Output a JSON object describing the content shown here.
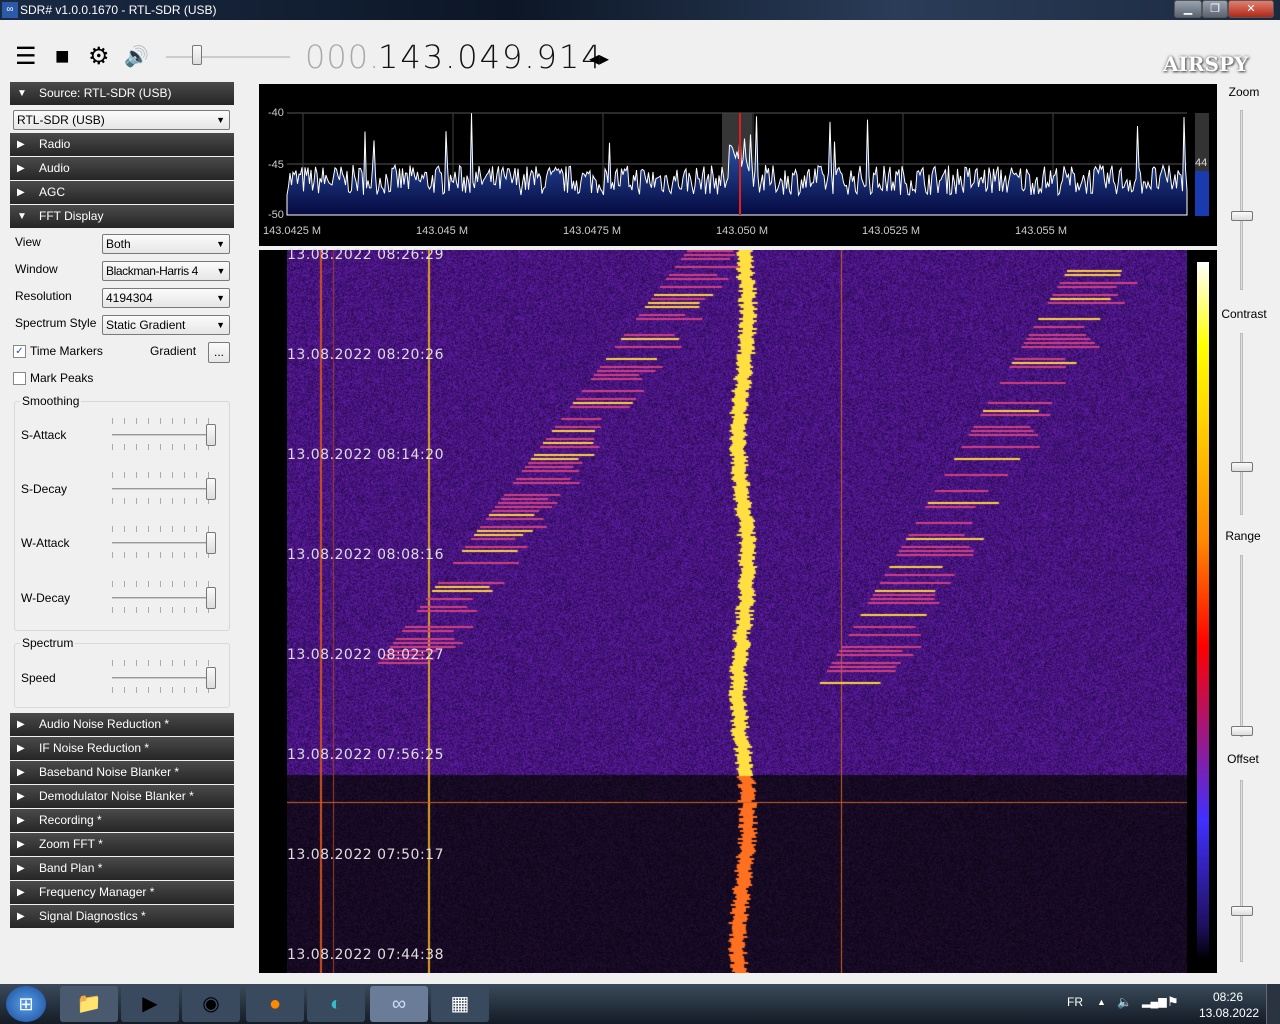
{
  "window": {
    "title": "SDR# v1.0.0.1670 - RTL-SDR (USB)",
    "min": "▁",
    "max": "❐",
    "close": "✕"
  },
  "toolbar": {
    "menu_icon": "☰",
    "stop_icon": "■",
    "settings_icon": "⚙",
    "volume_icon": "🔊",
    "volume_level": 0.15,
    "freq_prefix": "000.",
    "frequency": "143.049.914",
    "tune_icon": "◂▸",
    "logo": "AIRSPY"
  },
  "sidebar": {
    "source_header": "Source: RTL-SDR (USB)",
    "source_value": "RTL-SDR (USB)",
    "sections_top": [
      "Radio",
      "Audio",
      "AGC"
    ],
    "fft_header": "FFT Display",
    "view": {
      "label": "View",
      "value": "Both"
    },
    "window": {
      "label": "Window",
      "value": "Blackman-Harris 4"
    },
    "resolution": {
      "label": "Resolution",
      "value": "4194304"
    },
    "style": {
      "label": "Spectrum Style",
      "value": "Static Gradient"
    },
    "time_markers": {
      "label": "Time Markers",
      "checked": true
    },
    "gradient": {
      "label": "Gradient",
      "button": "..."
    },
    "mark_peaks": {
      "label": "Mark Peaks",
      "checked": false
    },
    "smoothing": {
      "title": "Smoothing",
      "sliders": [
        "S-Attack",
        "S-Decay",
        "W-Attack",
        "W-Decay"
      ]
    },
    "spectrum": {
      "title": "Spectrum",
      "speed": "Speed"
    },
    "sections_bottom": [
      "Audio Noise Reduction *",
      "IF Noise Reduction *",
      "Baseband Noise Blanker *",
      "Demodulator Noise Blanker *",
      "Recording *",
      "Zoom FFT *",
      "Band Plan *",
      "Frequency Manager *",
      "Signal Diagnostics *"
    ]
  },
  "spectrum": {
    "y_ticks": [
      "-40",
      "-45",
      "-50"
    ],
    "x_ticks": [
      "143.0425 M",
      "143.045 M",
      "143.0475 M",
      "143.050 M",
      "143.0525 M",
      "143.055 M"
    ],
    "level": "44"
  },
  "waterfall": {
    "time_markers": [
      "13.08.2022 08:26:29",
      "13.08.2022 08:20:26",
      "13.08.2022 08:14:20",
      "13.08.2022 08:08:16",
      "13.08.2022 08:02:27",
      "13.08.2022 07:56:25",
      "13.08.2022 07:50:17",
      "13.08.2022 07:44:38"
    ]
  },
  "right": {
    "zoom": "Zoom",
    "contrast": "Contrast",
    "range": "Range",
    "offset": "Offset"
  },
  "taskbar": {
    "lang": "FR",
    "time": "08:26",
    "date": "13.08.2022"
  }
}
